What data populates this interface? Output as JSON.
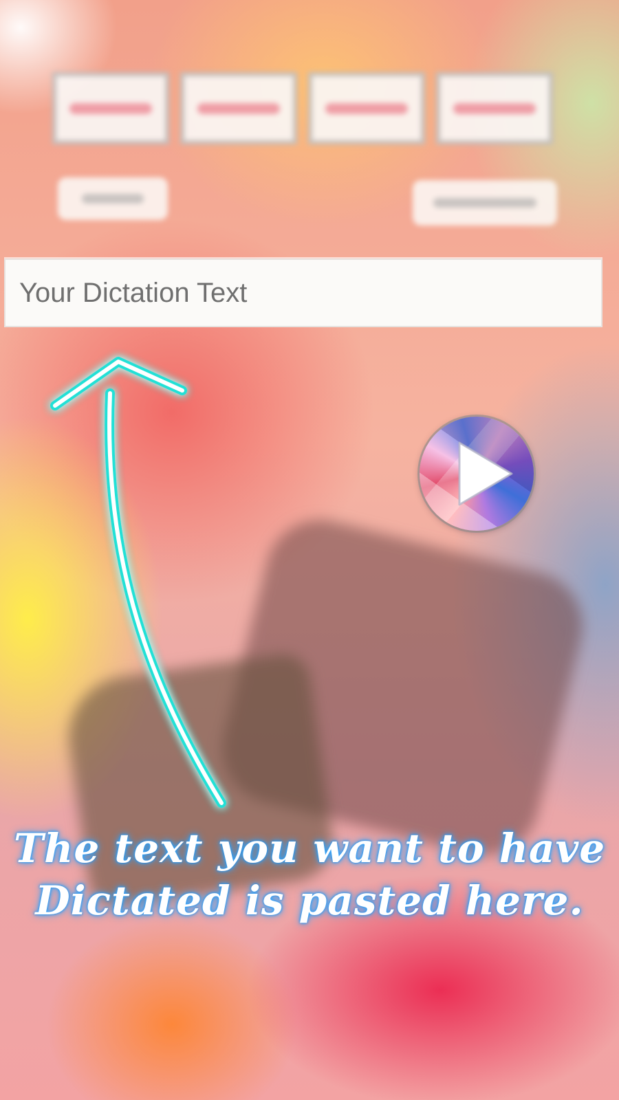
{
  "dictation": {
    "placeholder": "Your Dictation Text",
    "value": ""
  },
  "tutorial": {
    "caption_line1": "The text you want to have",
    "caption_line2": "Dictated is pasted here."
  },
  "icons": {
    "play": "play-icon",
    "arrow": "arrow-up-icon"
  },
  "colors": {
    "arrow_glow": "#21e0d6",
    "caption_glow": "#2fa6ff",
    "field_bg": "#fbfaf8"
  }
}
